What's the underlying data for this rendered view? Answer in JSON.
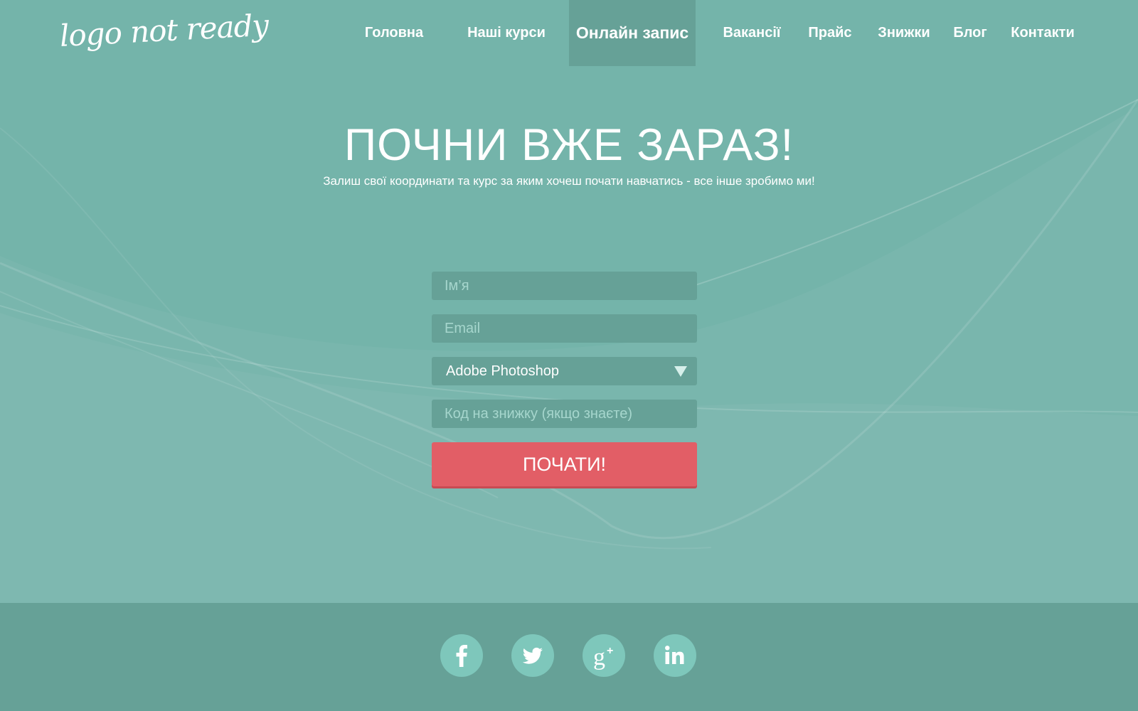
{
  "logo": {
    "text": "logo not ready"
  },
  "nav": {
    "items": [
      {
        "label": "Головна"
      },
      {
        "label": "Наші курси"
      },
      {
        "label": "Онлайн запис",
        "active": true
      },
      {
        "label": "Вакансії"
      },
      {
        "label": "Прайс"
      },
      {
        "label": "Знижки"
      },
      {
        "label": "Блог"
      },
      {
        "label": "Контакти"
      }
    ]
  },
  "hero": {
    "title": "ПОЧНИ ВЖЕ ЗАРАЗ!",
    "subtitle": "Залиш свої координати та курс за яким хочеш почати навчатись - все інше зробимо ми!"
  },
  "form": {
    "name_placeholder": "Ім’я",
    "email_placeholder": "Email",
    "course_selected": "Adobe Photoshop",
    "discount_placeholder": "Код на знижку (якщо знаєте)",
    "submit_label": "ПОЧАТИ!"
  },
  "footer": {
    "social": [
      {
        "icon": "facebook-icon"
      },
      {
        "icon": "twitter-icon"
      },
      {
        "icon": "google-plus-icon"
      },
      {
        "icon": "linkedin-icon"
      }
    ]
  },
  "colors": {
    "background": "#74b4aa",
    "panel": "#66a197",
    "accent": "#e25e66",
    "social_circle": "#7ec7bb"
  }
}
